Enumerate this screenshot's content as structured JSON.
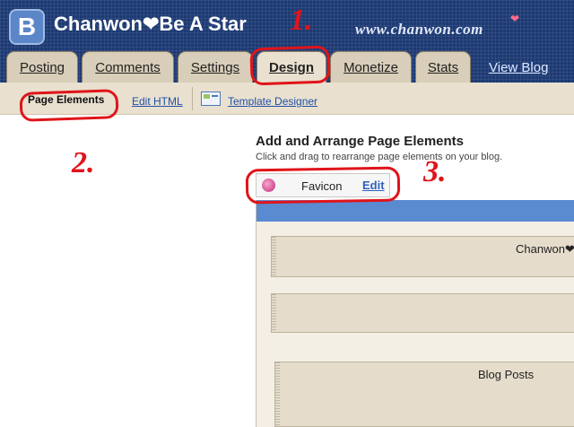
{
  "header": {
    "logo_letter": "B",
    "blog_title": "Chanwon❤Be A Star",
    "blog_url": "www.chanwon.com",
    "heart_glyph": "❤"
  },
  "tabs": [
    {
      "label": "Posting",
      "active": false
    },
    {
      "label": "Comments",
      "active": false
    },
    {
      "label": "Settings",
      "active": false
    },
    {
      "label": "Design",
      "active": true
    },
    {
      "label": "Monetize",
      "active": false
    },
    {
      "label": "Stats",
      "active": false
    }
  ],
  "view_blog_label": "View Blog",
  "subnav": {
    "page_elements": "Page Elements",
    "edit_html": "Edit HTML",
    "template_designer": "Template Designer"
  },
  "main": {
    "heading": "Add and Arrange Page Elements",
    "subheading": "Click and drag to rearrange page elements on your blog."
  },
  "favicon_widget": {
    "label": "Favicon",
    "edit_label": "Edit"
  },
  "layout": {
    "header_widget_label": "Chanwon❤",
    "blog_posts_label": "Blog Posts"
  },
  "annotations": [
    "1.",
    "2.",
    "3."
  ],
  "colors": {
    "header_bg": "#1d3a73",
    "tab_bg": "#d8ceb9",
    "subnav_bg": "#e9e0cf",
    "annotation_red": "#e0141a",
    "layout_bar_blue": "#5a8ad0"
  }
}
